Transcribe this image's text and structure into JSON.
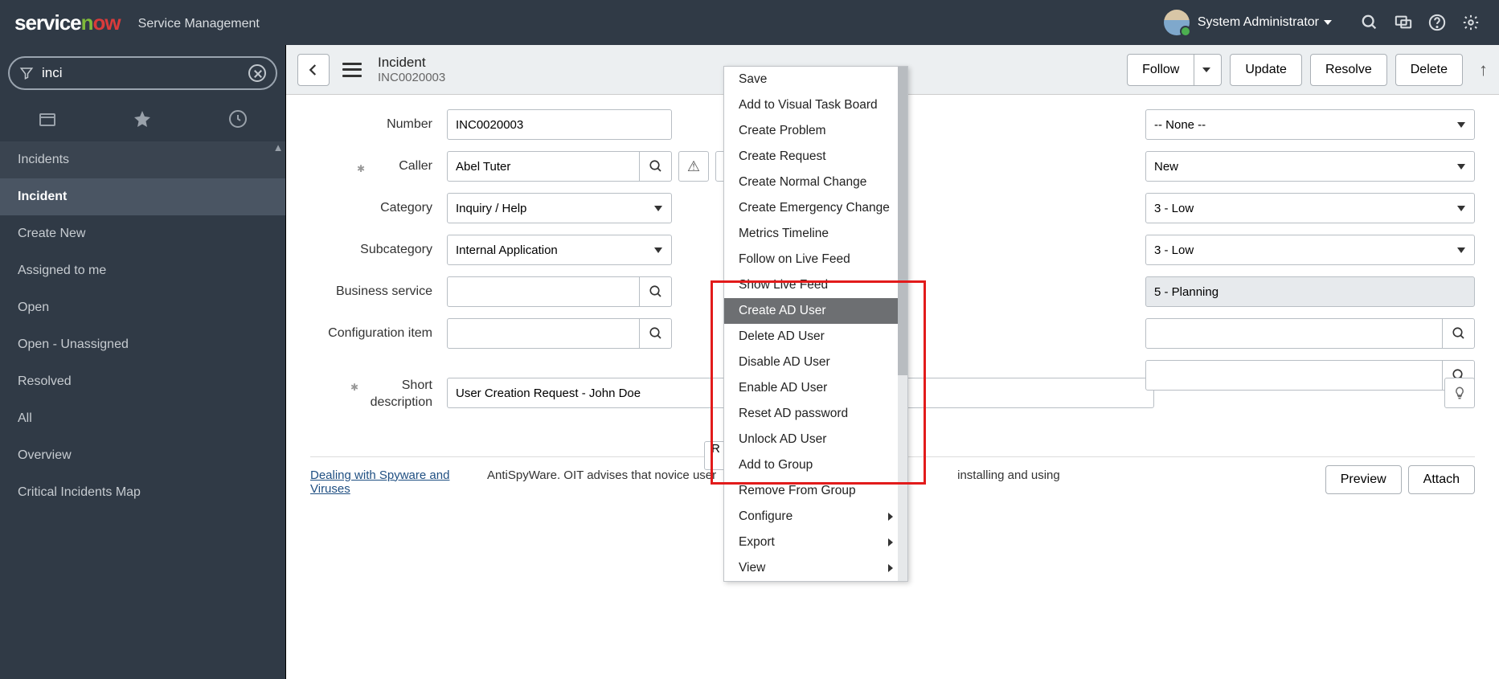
{
  "brand": {
    "a": "service",
    "b": "n",
    "c": "ow",
    "sub": "Service Management"
  },
  "user": {
    "name": "System Administrator"
  },
  "search": {
    "value": "inci"
  },
  "nav": {
    "items": [
      {
        "label": "Incidents",
        "cls": "light"
      },
      {
        "label": "Incident",
        "cls": "active"
      },
      {
        "label": "Create New",
        "cls": ""
      },
      {
        "label": "Assigned to me",
        "cls": ""
      },
      {
        "label": "Open",
        "cls": ""
      },
      {
        "label": "Open - Unassigned",
        "cls": ""
      },
      {
        "label": "Resolved",
        "cls": ""
      },
      {
        "label": "All",
        "cls": ""
      },
      {
        "label": "Overview",
        "cls": ""
      },
      {
        "label": "Critical Incidents Map",
        "cls": ""
      }
    ]
  },
  "header": {
    "type": "Incident",
    "number": "INC0020003",
    "follow": "Follow",
    "update": "Update",
    "resolve": "Resolve",
    "delete": "Delete"
  },
  "form": {
    "labels": {
      "number": "Number",
      "caller": "Caller",
      "category": "Category",
      "subcategory": "Subcategory",
      "business_service": "Business service",
      "ci": "Configuration item",
      "short_desc_a": "Short",
      "short_desc_b": "description"
    },
    "values": {
      "number": "INC0020003",
      "caller": "Abel Tuter",
      "category": "Inquiry / Help",
      "subcategory": "Internal Application",
      "business_service": "",
      "ci": "",
      "short_desc": "User Creation Request - John Doe"
    }
  },
  "right": {
    "r1": "-- None --",
    "r2": "New",
    "r3": "3 - Low",
    "r4": "3 - Low",
    "r5": "5 - Planning"
  },
  "related": {
    "truncated_btn": "R",
    "link": "Dealing with Spyware and Viruses",
    "desc": "AntiSpyWare. OIT advises that novice user",
    "desc2": "installing and using",
    "preview": "Preview",
    "attach": "Attach"
  },
  "context_menu": [
    {
      "label": "Save"
    },
    {
      "label": "Add to Visual Task Board"
    },
    {
      "label": "Create Problem"
    },
    {
      "label": "Create Request"
    },
    {
      "label": "Create Normal Change"
    },
    {
      "label": "Create Emergency Change"
    },
    {
      "label": "Metrics Timeline"
    },
    {
      "label": "Follow on Live Feed"
    },
    {
      "label": "Show Live Feed"
    },
    {
      "label": "Create AD User",
      "hov": true
    },
    {
      "label": "Delete AD User"
    },
    {
      "label": "Disable AD User"
    },
    {
      "label": "Enable AD User"
    },
    {
      "label": "Reset AD password"
    },
    {
      "label": "Unlock AD User"
    },
    {
      "label": "Add to Group"
    },
    {
      "label": "Remove From Group"
    },
    {
      "label": "Configure",
      "sub": true
    },
    {
      "label": "Export",
      "sub": true
    },
    {
      "label": "View",
      "sub": true
    }
  ]
}
